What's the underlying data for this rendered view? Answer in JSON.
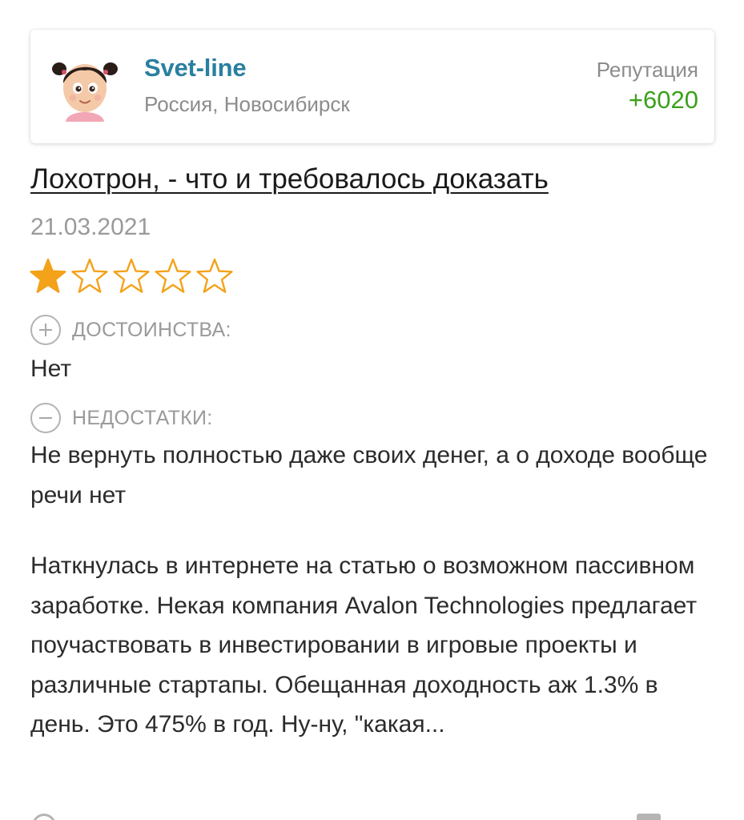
{
  "author": {
    "name": "Svet-line",
    "location": "Россия, Новосибирск",
    "reputation_label": "Репутация",
    "reputation_value": "+6020",
    "avatar_icon": "girl-avatar"
  },
  "review": {
    "title": "Лохотрон, - что и требовалось доказать",
    "date": "21.03.2021",
    "rating": 1,
    "rating_max": 5,
    "star_color": "#f3a21a",
    "pros": {
      "label": "ДОСТОИНСТВА:",
      "text": "Нет"
    },
    "cons": {
      "label": "НЕДОСТАТКИ:",
      "text": "Не вернуть полностью даже своих денег, а о доходе вообще речи нет"
    },
    "body": "Наткнулась в интернете на статью о возможном пассивном заработке. Некая компания Avalon Technologies предлагает поучаствовать в инвестировании в игровые проекты и различные стартапы. Обещанная доходность аж 1.3% в день. Это 475% в год. Ну-ну, \"какая..."
  },
  "colors": {
    "author_name": "#2a7fa0",
    "reputation": "#3aa11a",
    "muted": "#9a9a9a"
  }
}
